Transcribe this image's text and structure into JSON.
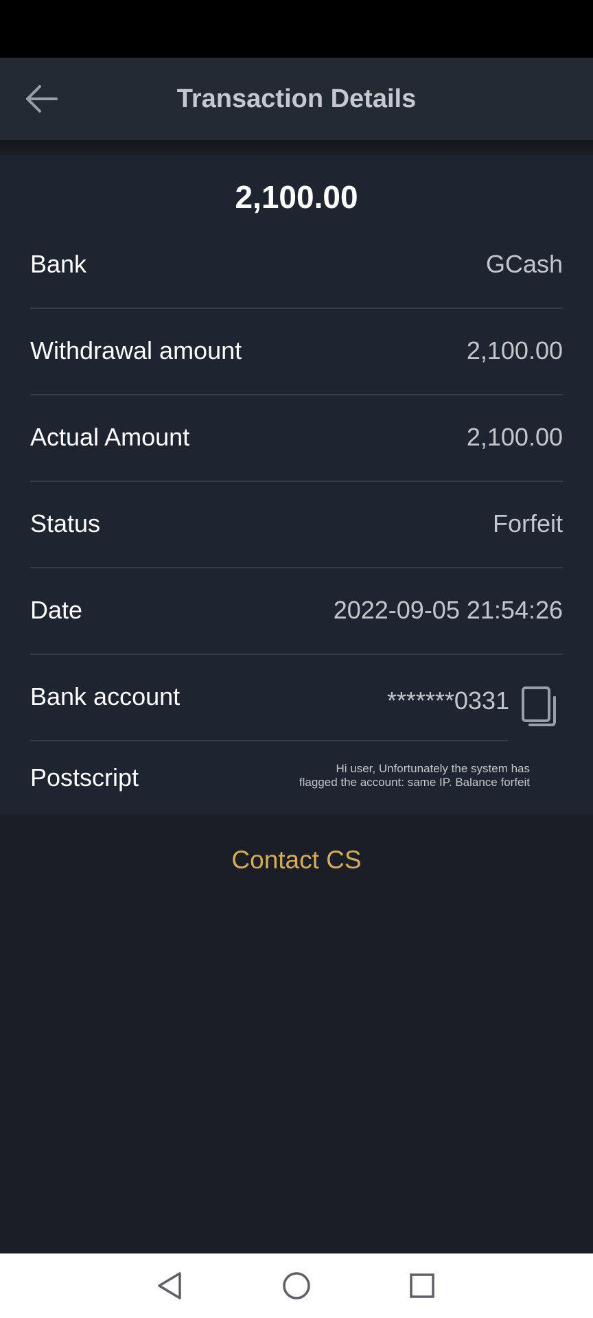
{
  "header": {
    "title": "Transaction Details"
  },
  "summary": {
    "amount": "2,100.00"
  },
  "details": {
    "bank": {
      "label": "Bank",
      "value": "GCash"
    },
    "withdrawal": {
      "label": "Withdrawal amount",
      "value": "2,100.00"
    },
    "actual": {
      "label": "Actual Amount",
      "value": "2,100.00"
    },
    "status": {
      "label": "Status",
      "value": "Forfeit"
    },
    "date": {
      "label": "Date",
      "value": "2022-09-05 21:54:26"
    },
    "account": {
      "label": "Bank account",
      "value": "*******0331"
    },
    "postscript": {
      "label": "Postscript",
      "line1": "Hi user, Unfortunately the system has",
      "line2": "flagged the account: same IP. Balance forfeit"
    }
  },
  "actions": {
    "contact_label": "Contact CS"
  },
  "colors": {
    "background": "#1b1e26",
    "card": "#1f2530",
    "header": "#232a34",
    "accent": "#d4ac5c"
  },
  "icons": {
    "back": "arrow-left-icon",
    "copy": "copy-icon",
    "nav_back": "triangle-back-icon",
    "nav_home": "circle-home-icon",
    "nav_recents": "square-recents-icon"
  }
}
